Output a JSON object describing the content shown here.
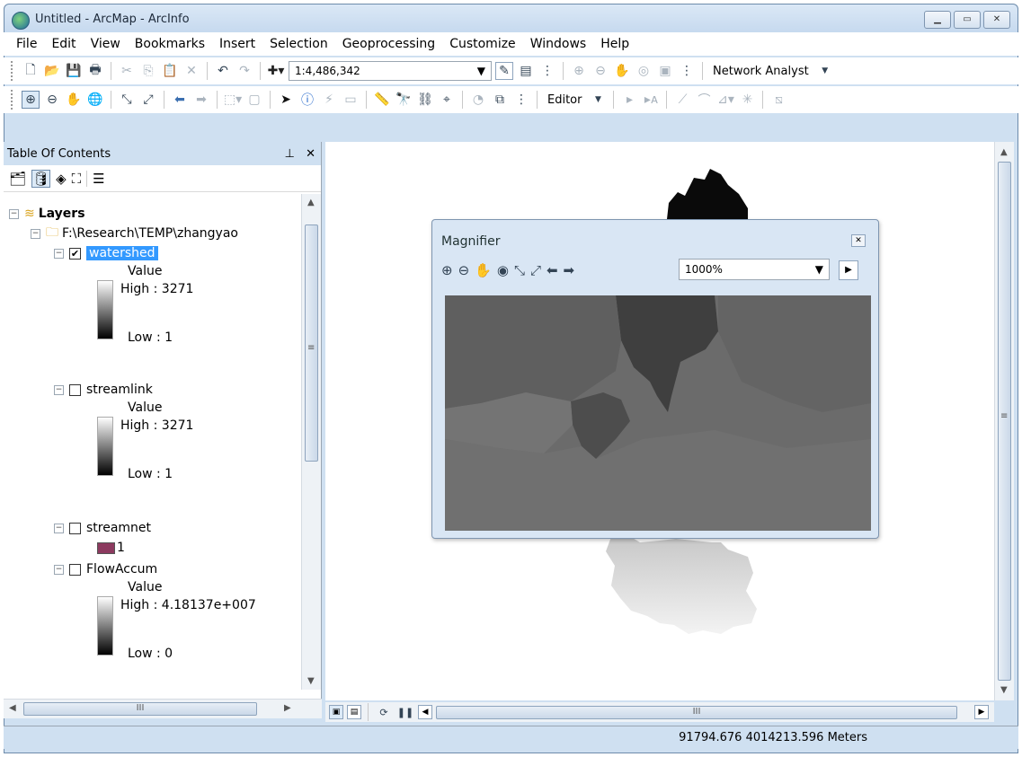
{
  "window": {
    "title": "Untitled - ArcMap - ArcInfo"
  },
  "menu": [
    "File",
    "Edit",
    "View",
    "Bookmarks",
    "Insert",
    "Selection",
    "Geoprocessing",
    "Customize",
    "Windows",
    "Help"
  ],
  "toolbar": {
    "scale": "1:4,486,342",
    "network_analyst": "Network Analyst",
    "editor": "Editor"
  },
  "toc": {
    "title": "Table Of Contents",
    "root": "Layers",
    "folder": "F:\\Research\\TEMP\\zhangyao",
    "layers": [
      {
        "name": "watershed",
        "checked": true,
        "legend_title": "Value",
        "high": "High : 3271",
        "low": "Low : 1"
      },
      {
        "name": "streamlink",
        "checked": false,
        "legend_title": "Value",
        "high": "High : 3271",
        "low": "Low : 1"
      },
      {
        "name": "streamnet",
        "checked": false,
        "class_label": "1"
      },
      {
        "name": "FlowAccum",
        "checked": false,
        "legend_title": "Value",
        "high": "High : 4.18137e+007",
        "low": "Low : 0"
      }
    ]
  },
  "magnifier": {
    "title": "Magnifier",
    "zoom": "1000%"
  },
  "status": {
    "coords": "91794.676  4014213.596 Meters"
  },
  "colors": {
    "chrome": "#cfe0f1",
    "selection": "#3399ff",
    "streamnet_swatch": "#8c3a5f"
  }
}
